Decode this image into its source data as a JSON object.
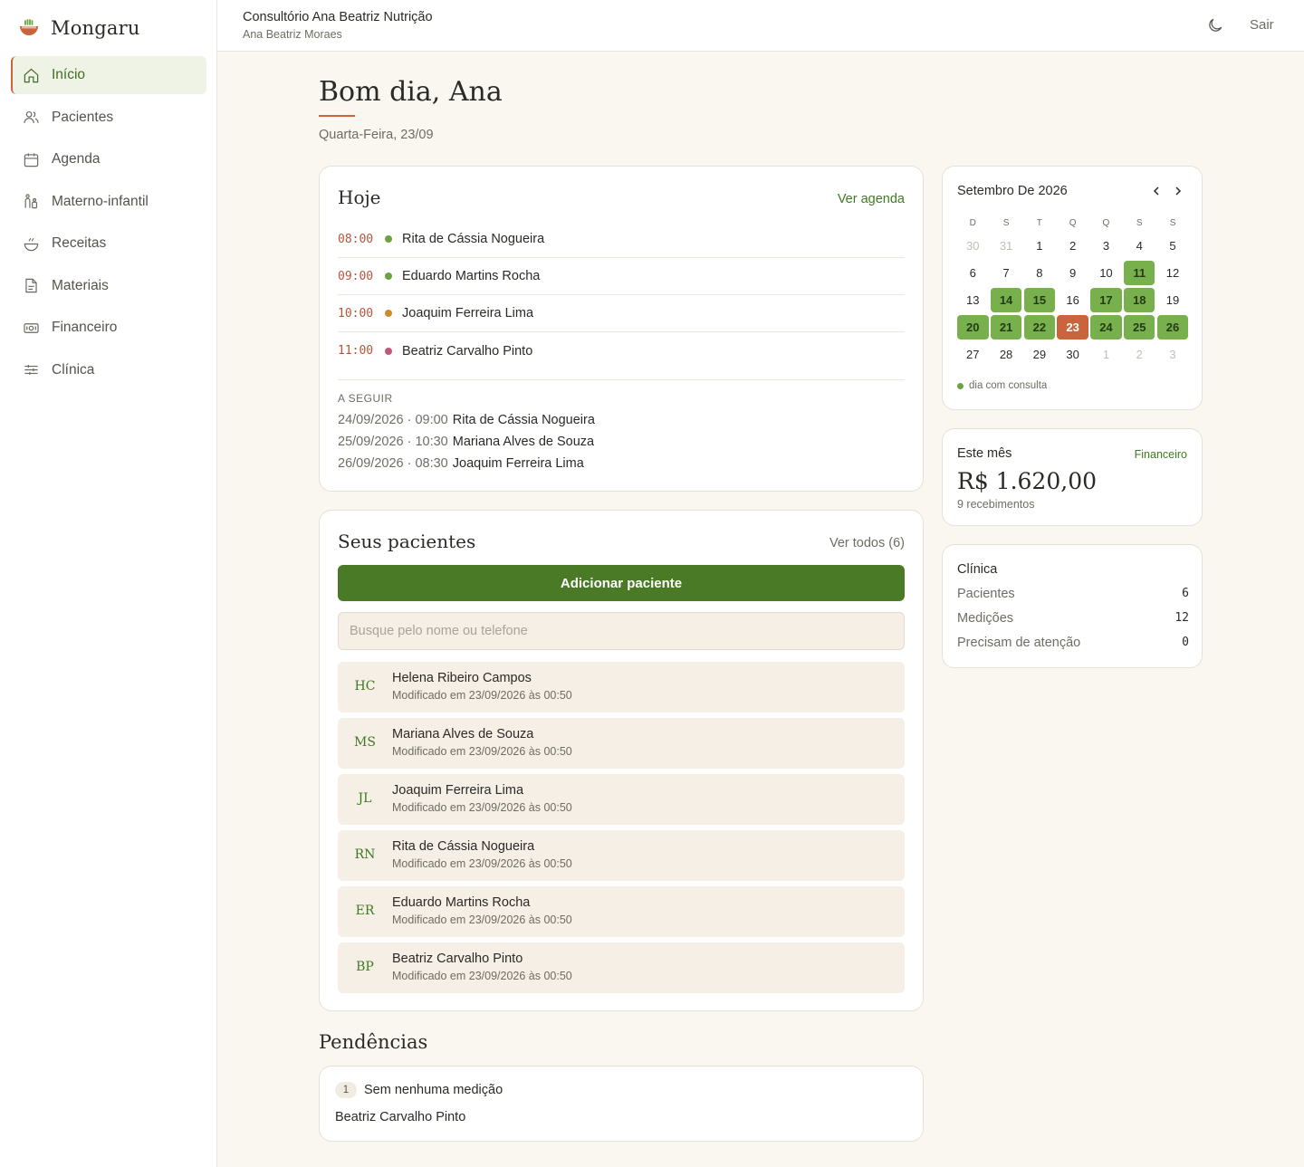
{
  "brand": {
    "name": "Mongaru"
  },
  "nav": [
    {
      "label": "Início",
      "icon": "home-icon",
      "active": true
    },
    {
      "label": "Pacientes",
      "icon": "users-icon"
    },
    {
      "label": "Agenda",
      "icon": "calendar-icon"
    },
    {
      "label": "Materno-infantil",
      "icon": "mother-child-icon"
    },
    {
      "label": "Receitas",
      "icon": "bowl-icon"
    },
    {
      "label": "Materiais",
      "icon": "document-icon"
    },
    {
      "label": "Financeiro",
      "icon": "money-icon"
    },
    {
      "label": "Clínica",
      "icon": "sliders-icon"
    }
  ],
  "topbar": {
    "title": "Consultório Ana Beatriz Nutrição",
    "subtitle": "Ana Beatriz Moraes",
    "logout": "Sair"
  },
  "greeting": {
    "title": "Bom dia, Ana",
    "date": "Quarta-Feira, 23/09"
  },
  "today": {
    "title": "Hoje",
    "link": "Ver agenda",
    "appointments": [
      {
        "time": "08:00",
        "name": "Rita de Cássia Nogueira",
        "color": "#6aa33f"
      },
      {
        "time": "09:00",
        "name": "Eduardo Martins Rocha",
        "color": "#6aa33f"
      },
      {
        "time": "10:00",
        "name": "Joaquim Ferreira Lima",
        "color": "#d08a2c"
      },
      {
        "time": "11:00",
        "name": "Beatriz Carvalho Pinto",
        "color": "#c0587c"
      }
    ],
    "next_label": "A SEGUIR",
    "next": [
      {
        "when": "24/09/2026 · 09:00",
        "name": "Rita de Cássia Nogueira"
      },
      {
        "when": "25/09/2026 · 10:30",
        "name": "Mariana Alves de Souza"
      },
      {
        "when": "26/09/2026 · 08:30",
        "name": "Joaquim Ferreira Lima"
      }
    ]
  },
  "patients": {
    "title": "Seus pacientes",
    "link": "Ver todos (6)",
    "add_label": "Adicionar paciente",
    "search_placeholder": "Busque pelo nome ou telefone",
    "list": [
      {
        "initials": "HC",
        "name": "Helena Ribeiro Campos",
        "modified": "Modificado em 23/09/2026 às 00:50"
      },
      {
        "initials": "MS",
        "name": "Mariana Alves de Souza",
        "modified": "Modificado em 23/09/2026 às 00:50"
      },
      {
        "initials": "JL",
        "name": "Joaquim Ferreira Lima",
        "modified": "Modificado em 23/09/2026 às 00:50"
      },
      {
        "initials": "RN",
        "name": "Rita de Cássia Nogueira",
        "modified": "Modificado em 23/09/2026 às 00:50"
      },
      {
        "initials": "ER",
        "name": "Eduardo Martins Rocha",
        "modified": "Modificado em 23/09/2026 às 00:50"
      },
      {
        "initials": "BP",
        "name": "Beatriz Carvalho Pinto",
        "modified": "Modificado em 23/09/2026 às 00:50"
      }
    ]
  },
  "pending": {
    "title": "Pendências",
    "count": "1",
    "item_title": "Sem nenhuma medição",
    "item_name": "Beatriz Carvalho Pinto"
  },
  "calendar": {
    "title": "Setembro De 2026",
    "weekdays": [
      "D",
      "S",
      "T",
      "Q",
      "Q",
      "S",
      "S"
    ],
    "days": [
      {
        "d": "30",
        "s": "out"
      },
      {
        "d": "31",
        "s": "out"
      },
      {
        "d": "1"
      },
      {
        "d": "2"
      },
      {
        "d": "3"
      },
      {
        "d": "4"
      },
      {
        "d": "5"
      },
      {
        "d": "6"
      },
      {
        "d": "7"
      },
      {
        "d": "8"
      },
      {
        "d": "9"
      },
      {
        "d": "10"
      },
      {
        "d": "11",
        "s": "consult"
      },
      {
        "d": "12"
      },
      {
        "d": "13"
      },
      {
        "d": "14",
        "s": "consult"
      },
      {
        "d": "15",
        "s": "consult"
      },
      {
        "d": "16"
      },
      {
        "d": "17",
        "s": "consult"
      },
      {
        "d": "18",
        "s": "consult"
      },
      {
        "d": "19"
      },
      {
        "d": "20",
        "s": "consult"
      },
      {
        "d": "21",
        "s": "consult"
      },
      {
        "d": "22",
        "s": "consult"
      },
      {
        "d": "23",
        "s": "today"
      },
      {
        "d": "24",
        "s": "consult"
      },
      {
        "d": "25",
        "s": "consult"
      },
      {
        "d": "26",
        "s": "consult"
      },
      {
        "d": "27"
      },
      {
        "d": "28"
      },
      {
        "d": "29"
      },
      {
        "d": "30"
      },
      {
        "d": "1",
        "s": "out"
      },
      {
        "d": "2",
        "s": "out"
      },
      {
        "d": "3",
        "s": "out"
      }
    ],
    "legend": "dia com consulta"
  },
  "month": {
    "label": "Este mês",
    "link": "Financeiro",
    "value": "R$ 1.620,00",
    "sub": "9 recebimentos"
  },
  "clinic": {
    "label": "Clínica",
    "rows": [
      {
        "label": "Pacientes",
        "value": "6"
      },
      {
        "label": "Medições",
        "value": "12"
      },
      {
        "label": "Precisam de atenção",
        "value": "0"
      }
    ]
  }
}
